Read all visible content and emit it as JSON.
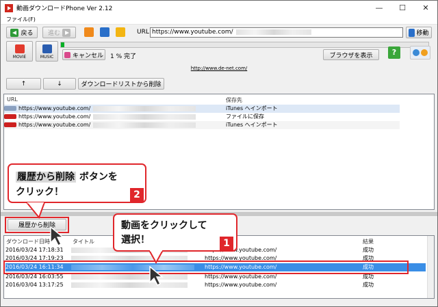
{
  "window": {
    "title": "動画ダウンロードPhone Ver 2.12",
    "min": "—",
    "max": "☐",
    "close": "✕"
  },
  "menu": {
    "file": "ファイル(F)"
  },
  "toolbar": {
    "back": "戻る",
    "forward": "進む",
    "url_label": "URL",
    "url_value": "https://www.youtube.com/",
    "move": "移動"
  },
  "toolbar2": {
    "movie": "MOVIE",
    "music": "MUSIC",
    "cancel": "キャンセル",
    "progress_text": "1 % 完了",
    "progress_fraction": 0.01,
    "browser": "ブラウザを表示"
  },
  "site_link": "http://www.de-net.com/",
  "queue": {
    "up": "↑",
    "down": "↓",
    "remove": "ダウンロードリストから削除",
    "col_url": "URL",
    "col_dest": "保存先",
    "rows": [
      {
        "url": "https://www.youtube.com/",
        "dest": "iTunes へインポート"
      },
      {
        "url": "https://www.youtube.com/",
        "dest": "ファイルに保存"
      },
      {
        "url": "https://www.youtube.com/",
        "dest": "iTunes へインポート"
      }
    ]
  },
  "history": {
    "delete_button": "履歴から削除",
    "col_date": "ダウンロード日時",
    "col_title": "タイトル",
    "col_result": "結果",
    "rows": [
      {
        "date": "2016/03/24 17:18:31",
        "url": "https://www.youtube.com/",
        "result": "成功"
      },
      {
        "date": "2016/03/24 17:19:23",
        "url": "https://www.youtube.com/",
        "result": "成功"
      },
      {
        "date": "2016/03/24 16:11:34",
        "url": "https://www.youtube.com/",
        "result": "成功"
      },
      {
        "date": "2016/03/24 16:03:55",
        "url": "https://www.youtube.com/",
        "result": "成功"
      },
      {
        "date": "2016/03/04 13:17:25",
        "url": "https://www.youtube.com/",
        "result": "成功"
      }
    ]
  },
  "callouts": {
    "c2_hl": "履歴から削除",
    "c2_rest": " ボタンを",
    "c2_line2": "クリック！",
    "c2_num": "2",
    "c1_line1": "動画をクリックして",
    "c1_line2": "選択！",
    "c1_num": "1"
  },
  "colors": {
    "selection": "#3a8ee6",
    "accent_red": "#e0262b"
  }
}
